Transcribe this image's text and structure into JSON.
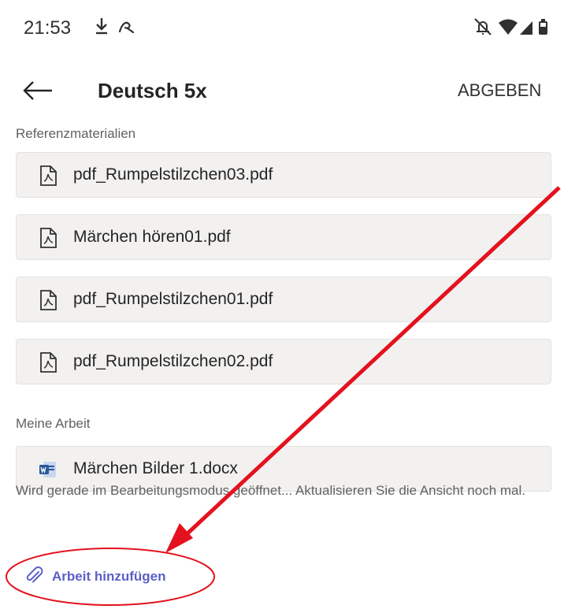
{
  "status_bar": {
    "time": "21:53",
    "icons": [
      "download-icon",
      "notification-icon",
      "bell-off-icon",
      "wifi-icon",
      "signal-icon",
      "battery-icon"
    ]
  },
  "app_bar": {
    "title": "Deutsch 5x",
    "submit_label": "ABGEBEN",
    "back_icon": "arrow-left-icon"
  },
  "reference": {
    "label": "Referenzmaterialien",
    "files": [
      {
        "name": "pdf_Rumpelstilzchen03.pdf",
        "icon": "pdf-icon"
      },
      {
        "name": "Märchen hören01.pdf",
        "icon": "pdf-icon"
      },
      {
        "name": "pdf_Rumpelstilzchen01.pdf",
        "icon": "pdf-icon"
      },
      {
        "name": "pdf_Rumpelstilzchen02.pdf",
        "icon": "pdf-icon"
      }
    ]
  },
  "my_work": {
    "label": "Meine Arbeit",
    "file": {
      "name": "Märchen Bilder 1.docx",
      "icon": "word-icon"
    },
    "note": "Wird gerade im Bearbeitungsmodus geöffnet... Aktualisieren Sie die Ansicht noch mal.",
    "add_label": "Arbeit hinzufügen"
  },
  "colors": {
    "accent": "#5b5fc7",
    "annotation": "#e4121e",
    "card_bg": "#f2f1f0"
  }
}
